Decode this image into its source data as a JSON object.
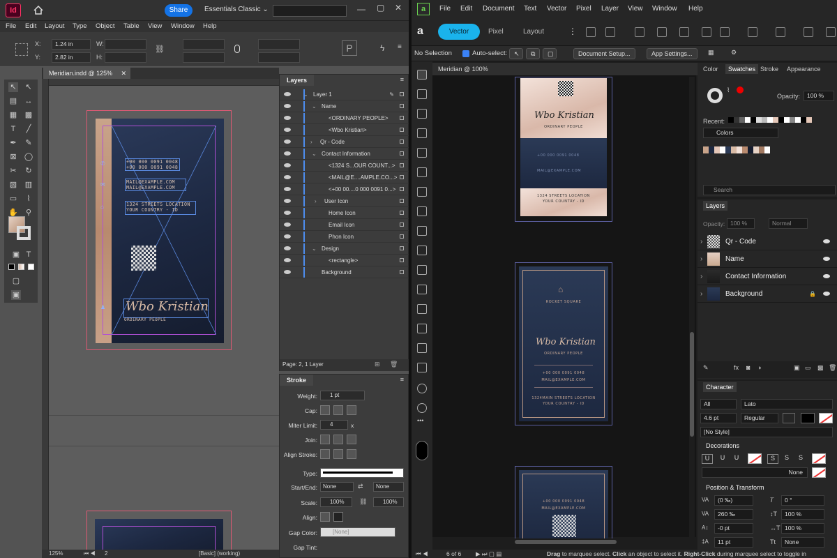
{
  "indesign": {
    "logo": "Id",
    "share_label": "Share",
    "workspace": "Essentials Classic",
    "menu": [
      "File",
      "Edit",
      "Layout",
      "Type",
      "Object",
      "Table",
      "View",
      "Window",
      "Help"
    ],
    "control": {
      "x_label": "X:",
      "x_value": "1.24 in",
      "y_label": "Y:",
      "y_value": "2.82 in",
      "w_label": "W:",
      "h_label": "H:"
    },
    "doc_tab": "Meridian.indd @ 125%",
    "card": {
      "phone1": "+00 000 0091 0048",
      "phone2": "+00 000 0091 0048",
      "mail1": "MAIL@EXAMPLE.COM",
      "mail2": "MAIL@EXAMPLE.COM",
      "addr1": "1324 STREETS LOCATION",
      "addr2": "YOUR COUNTRY - ID",
      "name": "Wbo Kristian",
      "role": "ORDINARY PEOPLE"
    },
    "layers_panel": {
      "title": "Layers",
      "rows": [
        "Layer 1",
        "Name",
        "<ORDINARY PEOPLE>",
        "<Wbo Kristian>",
        "Qr - Code",
        "Contact Information",
        "<1324 S...OUR COUNT...>",
        "<MAIL@E....AMPLE.CO...>",
        "<+00 00....0 000 0091 0...>",
        "User Icon",
        "Home Icon",
        "Email Icon",
        "Phon Icon",
        "Design",
        "<rectangle>",
        "Background"
      ],
      "footer": "Page: 2, 1 Layer"
    },
    "stroke_panel": {
      "title": "Stroke",
      "weight_label": "Weight:",
      "weight_value": "1 pt",
      "cap_label": "Cap:",
      "miter_label": "Miter Limit:",
      "miter_value": "4",
      "miter_unit": "x",
      "join_label": "Join:",
      "align_label": "Align Stroke:",
      "type_label": "Type:",
      "startend_label": "Start/End:",
      "start_value": "None",
      "end_value": "None",
      "scale_label": "Scale:",
      "scale_start": "100%",
      "scale_end": "100%",
      "align2_label": "Align:",
      "gapcolor_label": "Gap Color:",
      "gapcolor_value": "[None]",
      "gaptint_label": "Gap Tint:"
    },
    "status": {
      "zoom": "125%",
      "page": "2",
      "style": "[Basic] (working)"
    }
  },
  "affinity": {
    "logo": "a",
    "menu": [
      "File",
      "Edit",
      "Document",
      "Text",
      "Vector",
      "Pixel",
      "Layer",
      "View",
      "Window",
      "Help"
    ],
    "personas": {
      "vector": "Vector",
      "pixel": "Pixel",
      "layout": "Layout"
    },
    "context": {
      "selection": "No Selection",
      "autoselect": "Auto-select:",
      "doc_setup": "Document Setup...",
      "app_settings": "App Settings..."
    },
    "doc_tab": "Meridian @ 100%",
    "artboards": {
      "name": "Wbo Kristian",
      "role": "ORDINARY PEOPLE",
      "brand": "ROCKET SQUARE",
      "phone": "+00 000 0091 0048",
      "mail": "MAIL@EXAMPLE.COM",
      "addr1": "1324 STREETS LOCATION",
      "addr1b": "1324MAIN STREETS LOCATION",
      "addr2": "YOUR COUNTRY - ID"
    },
    "swatches_panel": {
      "tabs": [
        "Color",
        "Swatches",
        "Stroke",
        "Appearance"
      ],
      "opacity_label": "Opacity:",
      "opacity_value": "100 %",
      "recent_label": "Recent:",
      "palette": "Colors",
      "search": "Search"
    },
    "layers_panel": {
      "title": "Layers",
      "opacity_label": "Opacity:",
      "opacity_value": "100 %",
      "blend": "Normal",
      "rows": [
        "Qr - Code",
        "Name",
        "Contact Information",
        "Background"
      ]
    },
    "character_panel": {
      "title": "Character",
      "scope": "All",
      "font": "Lato",
      "size": "4.6 pt",
      "weight": "Regular",
      "style": "[No Style]",
      "decorations_label": "Decorations",
      "none_label": "None",
      "position_label": "Position & Transform",
      "kerning": "(0 ‰)",
      "tracking": "260 ‰",
      "baseline": "-0 pt",
      "leading": "11 pt",
      "shear": "0 °",
      "hscale": "100 %",
      "vscale": "100 %",
      "tt_value": "None"
    },
    "status": {
      "page": "6 of 6",
      "hint_drag": "Drag",
      "hint1": " to marquee select. ",
      "hint_click": "Click",
      "hint2": " an object to select it. ",
      "hint_right": "Right-Click",
      "hint3": " during marquee select to toggle in"
    },
    "colors": {
      "accent": "#1ab3ec",
      "brand_green": "#6ad34f",
      "navy": "#1d2840",
      "rose": "#e4c7b8"
    }
  }
}
